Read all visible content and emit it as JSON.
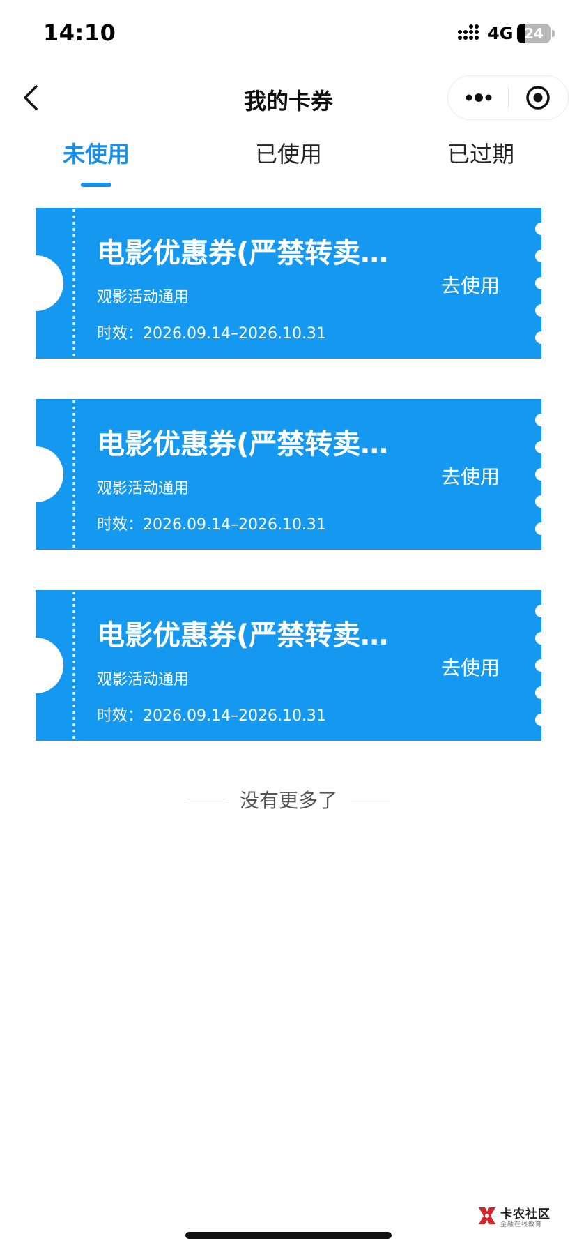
{
  "status_bar": {
    "time": "14:10",
    "network": "4G",
    "battery_level": "24",
    "battery_fraction": 0.24,
    "icons": [
      "signal-icon",
      "battery-icon"
    ]
  },
  "nav": {
    "title": "我的卡券",
    "icons": [
      "back-icon",
      "more-icon",
      "target-icon"
    ]
  },
  "tabs": [
    {
      "label": "未使用",
      "active": true
    },
    {
      "label": "已使用",
      "active": false
    },
    {
      "label": "已过期",
      "active": false
    }
  ],
  "coupons": [
    {
      "title": "电影优惠券(严禁转卖不可外借)",
      "subtitle": "观影活动通用",
      "validity": "时效：2026.09.14–2026.10.31",
      "action": "去使用"
    },
    {
      "title": "电影优惠券(严禁转卖不可外借)",
      "subtitle": "观影活动通用",
      "validity": "时效：2026.09.14–2026.10.31",
      "action": "去使用"
    },
    {
      "title": "电影优惠券(严禁转卖不可外借)",
      "subtitle": "观影活动通用",
      "validity": "时效：2026.09.14–2026.10.31",
      "action": "去使用"
    }
  ],
  "list_end_text": "没有更多了",
  "watermark": {
    "title": "卡农社区",
    "subtitle": "金融在线教育"
  },
  "colors": {
    "accent": "#1a8fe8",
    "coupon_bg": "#1598f0",
    "page_bg": "#ffffff"
  }
}
